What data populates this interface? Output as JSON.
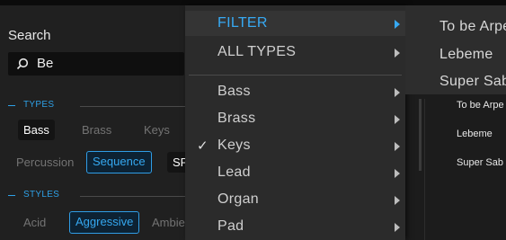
{
  "search": {
    "label": "Search",
    "value": "Be"
  },
  "types": {
    "header": "TYPES",
    "chips": [
      {
        "label": "Bass",
        "state": "active"
      },
      {
        "label": "Brass",
        "state": "dim"
      },
      {
        "label": "Keys",
        "state": "dim"
      },
      {
        "label": "Percussion",
        "state": "dim"
      },
      {
        "label": "Sequence",
        "state": "selected"
      },
      {
        "label": "SF",
        "state": "active"
      }
    ]
  },
  "styles": {
    "header": "STYLES",
    "chips": [
      {
        "label": "Acid",
        "state": "dim"
      },
      {
        "label": "Aggressive",
        "state": "selected"
      },
      {
        "label": "Ambie",
        "state": "dim"
      }
    ]
  },
  "menu": {
    "items": [
      {
        "label": "FILTER",
        "highlighted": true,
        "checked": false
      },
      {
        "label": "ALL TYPES",
        "highlighted": false,
        "checked": false
      },
      {
        "label": "Bass",
        "highlighted": false,
        "checked": false
      },
      {
        "label": "Brass",
        "highlighted": false,
        "checked": false
      },
      {
        "label": "Keys",
        "highlighted": false,
        "checked": true
      },
      {
        "label": "Lead",
        "highlighted": false,
        "checked": false
      },
      {
        "label": "Organ",
        "highlighted": false,
        "checked": false
      },
      {
        "label": "Pad",
        "highlighted": false,
        "checked": false
      }
    ],
    "check_glyph": "✓"
  },
  "submenu": {
    "items": [
      "To be Arpe",
      "Lebeme",
      "Super Sab"
    ]
  },
  "results": {
    "items": [
      "To be Arpe",
      "Lebeme",
      "Super Sab"
    ]
  },
  "colors": {
    "accent": "#37a9f3",
    "background": "#1b1b1b",
    "menu_bg": "#2b2b2b"
  }
}
